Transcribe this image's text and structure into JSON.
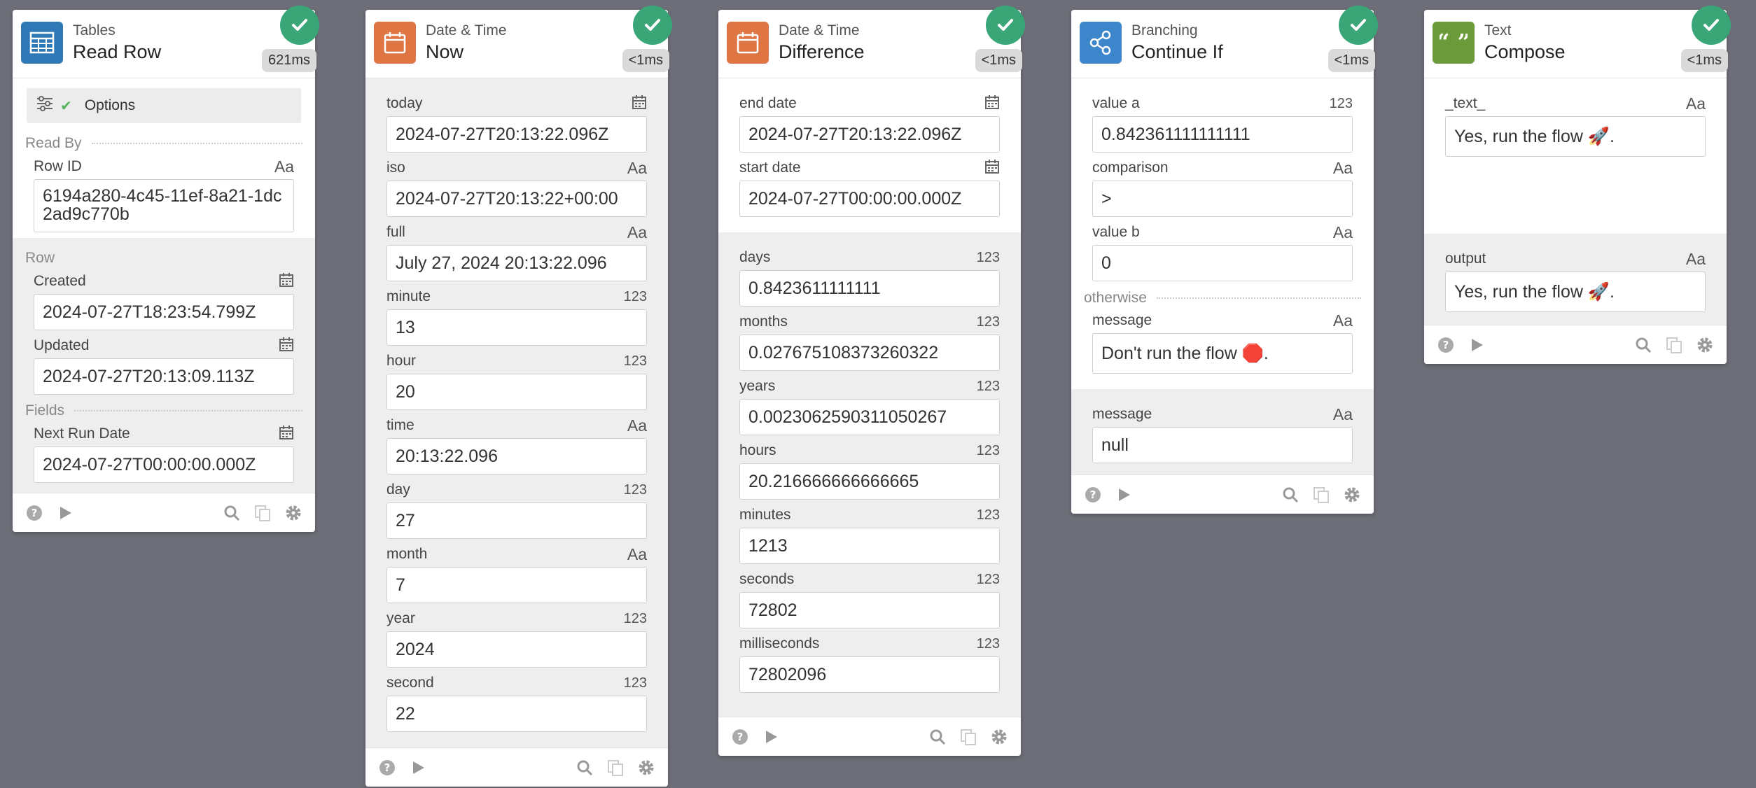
{
  "cards": {
    "c1": {
      "app": "Tables",
      "action": "Read Row",
      "timing": "621ms",
      "options": "Options",
      "group_read_by": "Read By",
      "row_id_label": "Row ID",
      "row_id_type": "Aa",
      "row_id_value": "6194a280-4c45-11ef-8a21-1dc2ad9c770b",
      "group_row": "Row",
      "created_label": "Created",
      "created_value": "2024-07-27T18:23:54.799Z",
      "updated_label": "Updated",
      "updated_value": "2024-07-27T20:13:09.113Z",
      "group_fields": "Fields",
      "next_run_label": "Next Run Date",
      "next_run_value": "2024-07-27T00:00:00.000Z"
    },
    "c2": {
      "app": "Date & Time",
      "action": "Now",
      "timing": "<1ms",
      "fields": [
        {
          "label": "today",
          "type": "cal",
          "value": "2024-07-27T20:13:22.096Z"
        },
        {
          "label": "iso",
          "type": "Aa",
          "value": "2024-07-27T20:13:22+00:00"
        },
        {
          "label": "full",
          "type": "Aa",
          "value": "July 27, 2024 20:13:22.096"
        },
        {
          "label": "minute",
          "type": "123",
          "value": "13"
        },
        {
          "label": "hour",
          "type": "123",
          "value": "20"
        },
        {
          "label": "time",
          "type": "Aa",
          "value": "20:13:22.096"
        },
        {
          "label": "day",
          "type": "123",
          "value": "27"
        },
        {
          "label": "month",
          "type": "Aa",
          "value": "7"
        },
        {
          "label": "year",
          "type": "123",
          "value": "2024"
        },
        {
          "label": "second",
          "type": "123",
          "value": "22"
        }
      ]
    },
    "c3": {
      "app": "Date & Time",
      "action": "Difference",
      "timing": "<1ms",
      "inputs": [
        {
          "label": "end date",
          "type": "cal",
          "value": "2024-07-27T20:13:22.096Z"
        },
        {
          "label": "start date",
          "type": "cal",
          "value": "2024-07-27T00:00:00.000Z"
        }
      ],
      "outputs": [
        {
          "label": "days",
          "type": "123",
          "value": "0.8423611111111"
        },
        {
          "label": "months",
          "type": "123",
          "value": "0.027675108373260322"
        },
        {
          "label": "years",
          "type": "123",
          "value": "0.0023062590311050267"
        },
        {
          "label": "hours",
          "type": "123",
          "value": "20.216666666666665"
        },
        {
          "label": "minutes",
          "type": "123",
          "value": "1213"
        },
        {
          "label": "seconds",
          "type": "123",
          "value": "72802"
        },
        {
          "label": "milliseconds",
          "type": "123",
          "value": "72802096"
        }
      ]
    },
    "c4": {
      "app": "Branching",
      "action": "Continue If",
      "timing": "<1ms",
      "inputs": [
        {
          "label": "value a",
          "type": "123",
          "value": "0.842361111111111"
        },
        {
          "label": "comparison",
          "type": "Aa",
          "value": ">"
        },
        {
          "label": "value b",
          "type": "Aa",
          "value": "0"
        }
      ],
      "otherwise": "otherwise",
      "otherwise_message_label": "message",
      "otherwise_message_type": "Aa",
      "otherwise_message_value": "Don't run the flow 🛑.",
      "output_message_label": "message",
      "output_message_type": "Aa",
      "output_message_value": "null"
    },
    "c5": {
      "app": "Text",
      "action": "Compose",
      "timing": "<1ms",
      "text_label": "_text_",
      "text_type": "Aa",
      "text_value": "Yes, run the flow 🚀.",
      "output_label": "output",
      "output_type": "Aa",
      "output_value": "Yes, run the flow 🚀."
    }
  },
  "colors": {
    "tables": "#2e78b6",
    "datetime": "#de7543",
    "branching": "#3d86cc",
    "text": "#6a9a3a",
    "success": "#3aa577"
  }
}
